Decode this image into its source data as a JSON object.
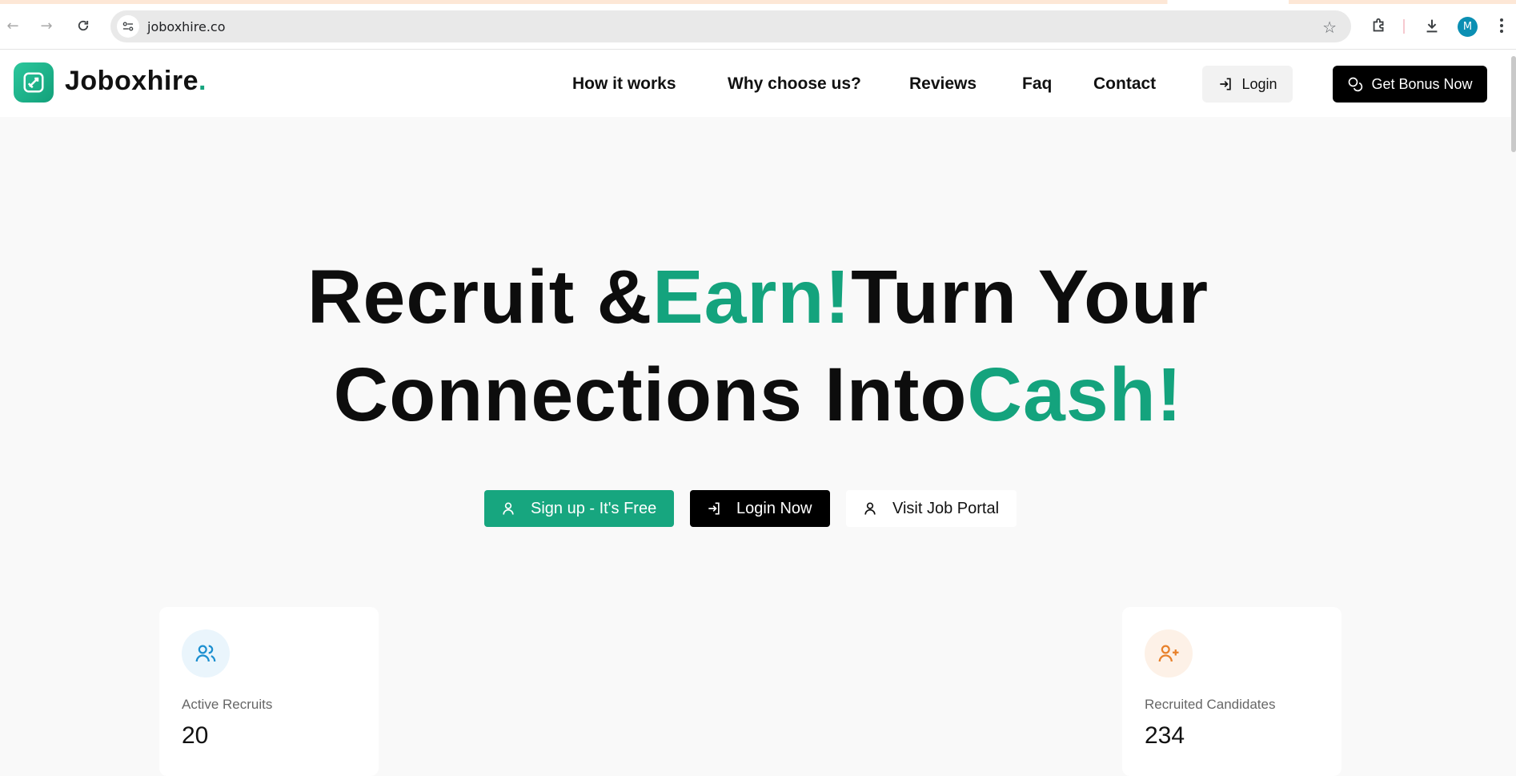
{
  "browser": {
    "url": "joboxhire.co",
    "profile_initial": "M"
  },
  "header": {
    "brand_name": "Joboxhire",
    "brand_dot": ".",
    "nav": [
      {
        "label": "How it works"
      },
      {
        "label": "Why choose us?"
      },
      {
        "label": "Reviews"
      },
      {
        "label": "Faq"
      },
      {
        "label": "Contact"
      }
    ],
    "login_label": "Login",
    "bonus_label": "Get Bonus Now"
  },
  "hero": {
    "line1_a": "Recruit &",
    "line1_accent": "Earn!",
    "line1_b": "Turn Your",
    "line2_a": "Connections Into",
    "line2_accent": "Cash!",
    "cta_signup": "Sign up - It's Free",
    "cta_login": "Login Now",
    "cta_portal": "Visit Job Portal"
  },
  "stats": {
    "active_label": "Active Recruits",
    "active_value": "20",
    "recruited_label": "Recruited Candidates",
    "recruited_value": "234"
  },
  "colors": {
    "accent_green": "#14a37d",
    "dark": "#0d0d0d"
  }
}
